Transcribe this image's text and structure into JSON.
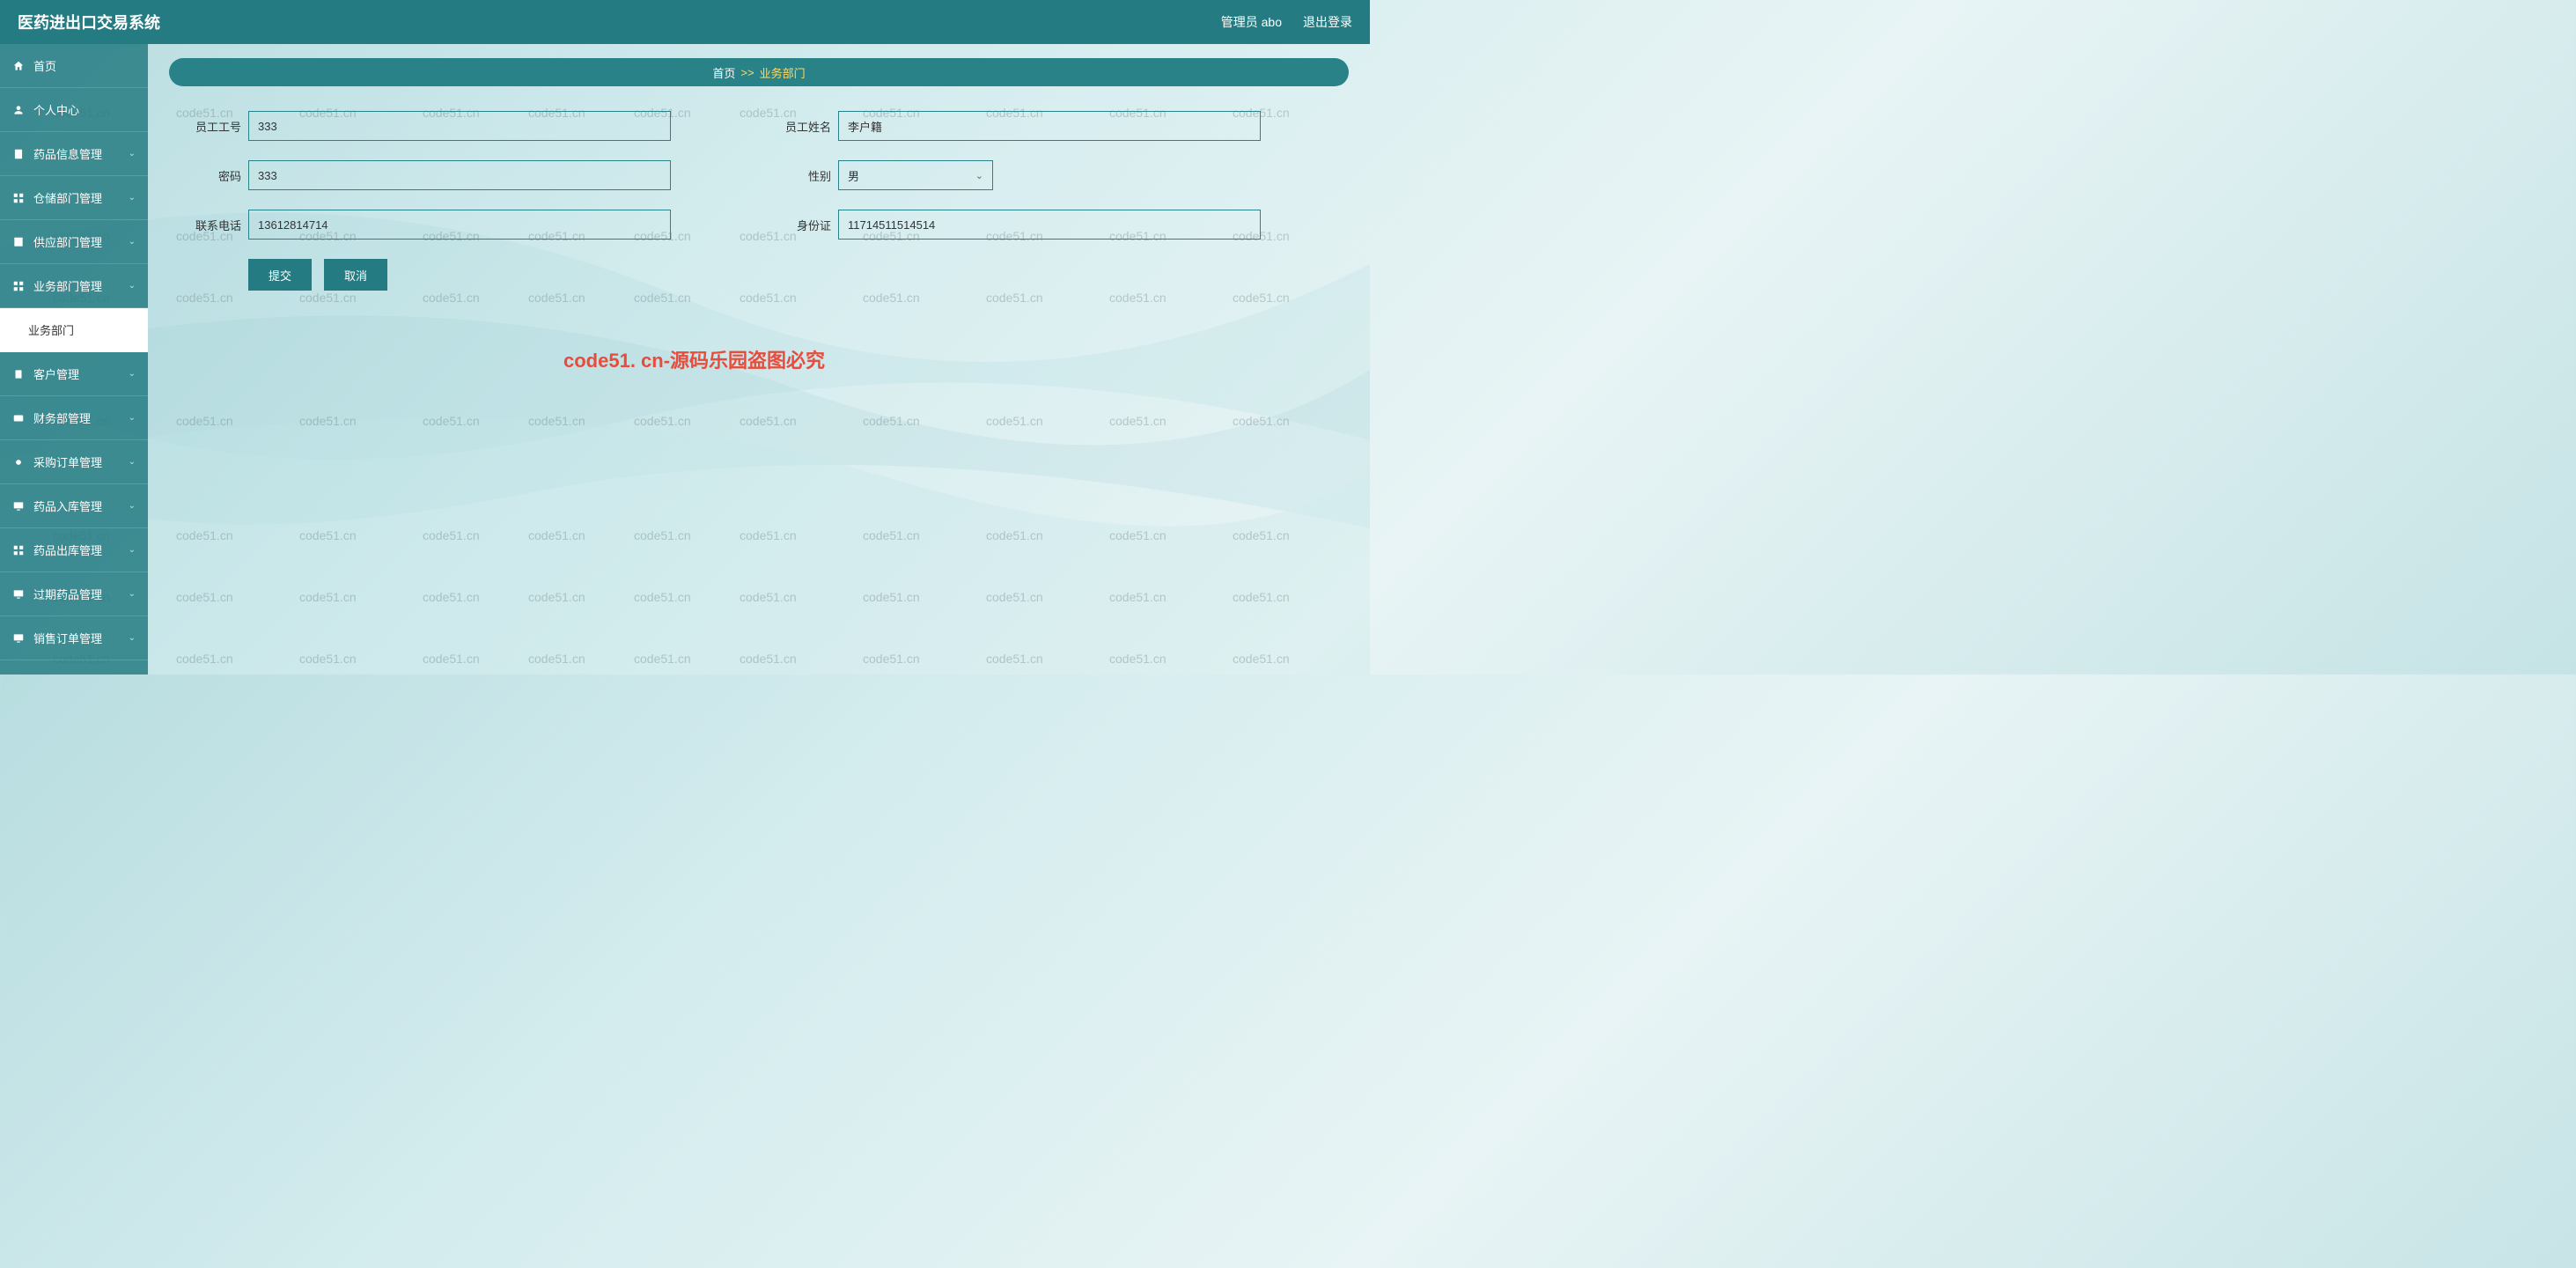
{
  "header": {
    "title": "医药进出口交易系统",
    "user_label": "管理员 abo",
    "logout": "退出登录"
  },
  "sidebar": {
    "items": [
      {
        "icon": "home",
        "label": "首页"
      },
      {
        "icon": "user",
        "label": "个人中心"
      },
      {
        "icon": "doc",
        "label": "药品信息管理",
        "expandable": true
      },
      {
        "icon": "grid",
        "label": "仓储部门管理",
        "expandable": true
      },
      {
        "icon": "box",
        "label": "供应部门管理",
        "expandable": true
      },
      {
        "icon": "grid",
        "label": "业务部门管理",
        "expandable": true
      },
      {
        "icon": "",
        "label": "业务部门",
        "active": true
      },
      {
        "icon": "clip",
        "label": "客户管理",
        "expandable": true
      },
      {
        "icon": "card",
        "label": "财务部管理",
        "expandable": true
      },
      {
        "icon": "dot",
        "label": "采购订单管理",
        "expandable": true
      },
      {
        "icon": "monitor",
        "label": "药品入库管理",
        "expandable": true
      },
      {
        "icon": "grid",
        "label": "药品出库管理",
        "expandable": true
      },
      {
        "icon": "monitor",
        "label": "过期药品管理",
        "expandable": true
      },
      {
        "icon": "monitor",
        "label": "销售订单管理",
        "expandable": true
      }
    ]
  },
  "breadcrumb": {
    "home": "首页",
    "sep": ">>",
    "current": "业务部门"
  },
  "form": {
    "emp_id_label": "员工工号",
    "emp_id_value": "333",
    "emp_name_label": "员工姓名",
    "emp_name_value": "李户籍",
    "password_label": "密码",
    "password_value": "333",
    "gender_label": "性别",
    "gender_value": "男",
    "phone_label": "联系电话",
    "phone_value": "13612814714",
    "idcard_label": "身份证",
    "idcard_value": "11714511514514",
    "submit": "提交",
    "cancel": "取消"
  },
  "watermark": {
    "text": "code51.cn",
    "main": "code51. cn-源码乐园盗图必究"
  }
}
